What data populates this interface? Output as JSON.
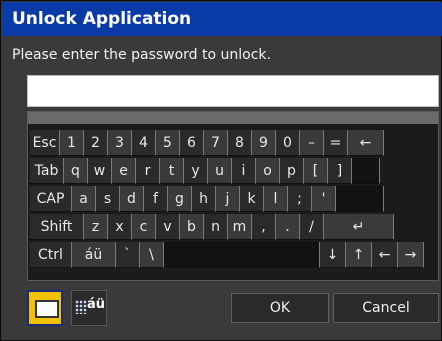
{
  "window": {
    "title": "Unlock Application"
  },
  "prompt": "Please enter the password to unlock.",
  "password_value": "",
  "keyboard": {
    "row1": [
      "Esc",
      "1",
      "2",
      "3",
      "4",
      "5",
      "6",
      "7",
      "8",
      "9",
      "0",
      "–",
      "=",
      "←"
    ],
    "row2": [
      "Tab",
      "q",
      "w",
      "e",
      "r",
      "t",
      "y",
      "u",
      "i",
      "o",
      "p",
      "[",
      "]",
      ""
    ],
    "row3": [
      "CAP",
      "a",
      "s",
      "d",
      "f",
      "g",
      "h",
      "j",
      "k",
      "l",
      ";",
      "'",
      ""
    ],
    "row4": [
      "Shift",
      "z",
      "x",
      "c",
      "v",
      "b",
      "n",
      "m",
      ",",
      ".",
      "/",
      "↵"
    ],
    "row5": [
      "Ctrl",
      "áü",
      "`",
      "\\",
      "",
      "↓",
      "↑",
      "←",
      "→"
    ]
  },
  "bottom": {
    "intl_label": "áü",
    "ok_label": "OK",
    "cancel_label": "Cancel"
  },
  "colors": {
    "title_bar": "#0a3aa6",
    "dialog_bg": "#3a3a3a",
    "keyboard_mode_active": "#f2c100"
  },
  "icons": {
    "keyboard_mode": "keyboard-icon",
    "international_mode": "international-keyboard-icon"
  }
}
